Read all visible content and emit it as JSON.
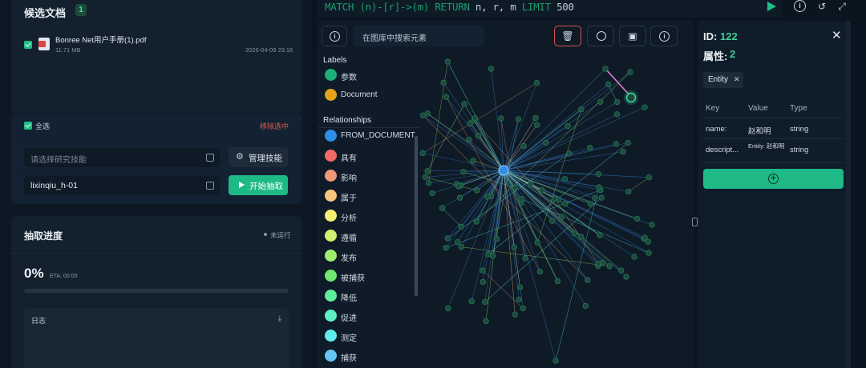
{
  "candidates": {
    "title": "候选文档",
    "count": "1",
    "file": {
      "name": "Bonree Net用户手册(1).pdf",
      "size": "11.71 MB",
      "date": "2026-04-09 23:16"
    }
  },
  "selection": {
    "select_all": "全选",
    "clear": "移除选中",
    "skill_placeholder": "请选择研究技能",
    "manage_label": "管理技能",
    "kb_value": "lixinqiu_h-01",
    "start_label": "开始抽取"
  },
  "progress": {
    "title": "抽取进度",
    "status": "未运行",
    "percent_text": "0%",
    "percent": 0,
    "eta": "ETA: 00:00",
    "log_title": "日志"
  },
  "query": {
    "parts": [
      "MATCH",
      " (n)-[r]->(m) ",
      "RETURN",
      " n, r, m ",
      "LIMIT",
      " 500"
    ]
  },
  "graph": {
    "search_placeholder": "在图库中搜索元素",
    "labels_heading": "Labels",
    "labels": [
      {
        "name": "参数",
        "color": "#1fae77"
      },
      {
        "name": "Document",
        "color": "#e3a21a"
      }
    ],
    "relationships_heading": "Relationships",
    "relationships": [
      {
        "name": "FROM_DOCUMENT",
        "color": "#2f8ee8"
      },
      {
        "name": "具有",
        "color": "#f26a68"
      },
      {
        "name": "影响",
        "color": "#f2977a"
      },
      {
        "name": "属于",
        "color": "#f8c77f"
      },
      {
        "name": "分析",
        "color": "#f5f073"
      },
      {
        "name": "遵循",
        "color": "#cff071"
      },
      {
        "name": "发布",
        "color": "#9eef6e"
      },
      {
        "name": "被捕获",
        "color": "#6ee86e"
      },
      {
        "name": "降低",
        "color": "#62ed9c"
      },
      {
        "name": "促进",
        "color": "#5ff0c2"
      },
      {
        "name": "测定",
        "color": "#60eeea"
      },
      {
        "name": "捕获",
        "color": "#64c6f2"
      }
    ]
  },
  "properties": {
    "id_label": "ID:",
    "id_value": "122",
    "attr_label": "属性:",
    "attr_value": "2",
    "entity_chip": "Entity",
    "columns": [
      "Key",
      "Value",
      "Type"
    ],
    "rows": [
      {
        "key": "name:",
        "value": "赵和明",
        "type": "string"
      },
      {
        "key": "descript...",
        "value": "Entity: 赵和明",
        "type": "string"
      }
    ]
  },
  "icons": {
    "delete": "trash-icon",
    "layout": "circle-icon",
    "export": "image-icon",
    "info": "info-icon",
    "history": "history-icon",
    "expand": "expand-icon",
    "run": "play-icon",
    "close": "close-icon",
    "add": "plus-circle-icon",
    "download": "download-icon",
    "settings": "gear-icon"
  },
  "colors": {
    "accent": "#1fb887",
    "danger": "#e25a4a",
    "node": "#1c4a3c"
  }
}
